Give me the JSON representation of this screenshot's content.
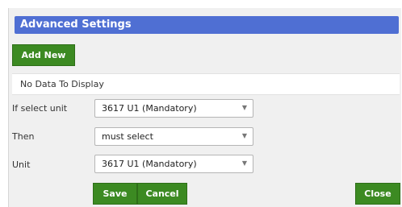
{
  "title": "Advanced Settings",
  "add_new_label": "Add New",
  "empty_message": "No Data To Display",
  "form": {
    "if_select_unit": {
      "label": "If select unit",
      "value": "3617 U1 (Mandatory)"
    },
    "then": {
      "label": "Then",
      "value": "must select"
    },
    "unit": {
      "label": "Unit",
      "value": "3617 U1 (Mandatory)"
    }
  },
  "buttons": {
    "save": "Save",
    "cancel": "Cancel",
    "close": "Close"
  },
  "colors": {
    "header_bg": "#4f6fd3",
    "button_bg": "#3c8a22"
  },
  "icons": {
    "dropdown": "chevron-down-icon"
  }
}
